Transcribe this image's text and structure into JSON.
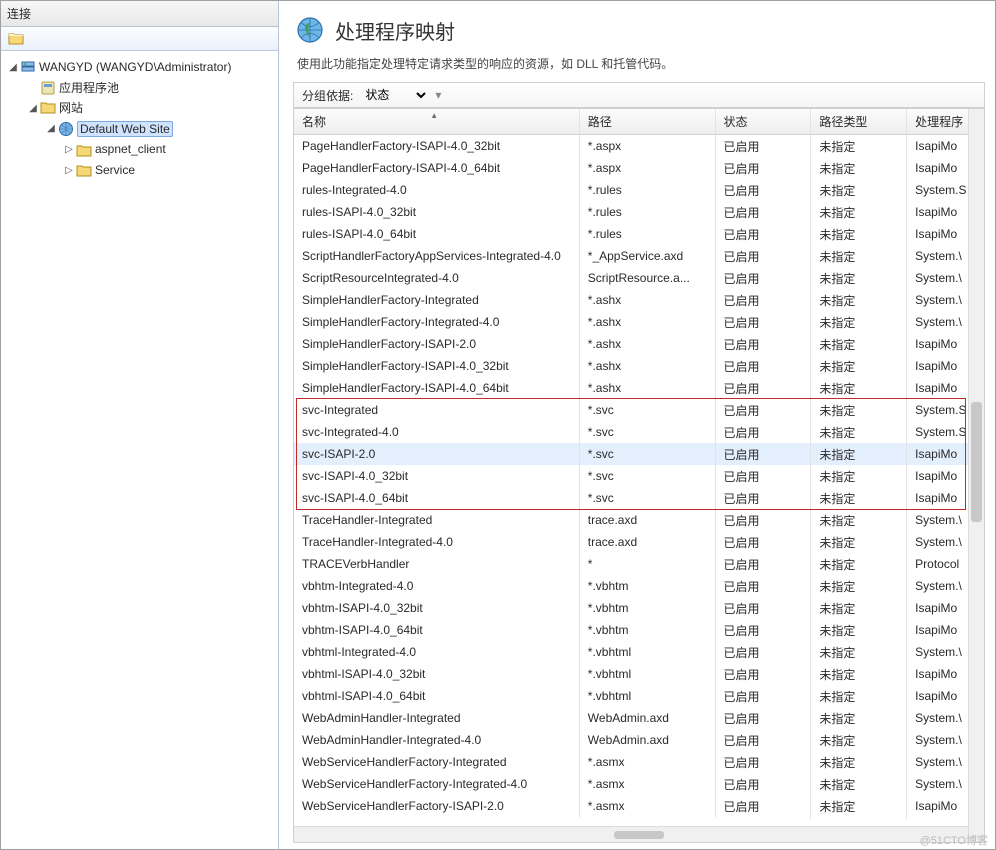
{
  "sidebar": {
    "header": "连接",
    "root_label": "WANGYD (WANGYD\\Administrator)",
    "app_pools": "应用程序池",
    "sites": "网站",
    "default_site": "Default Web Site",
    "child1": "aspnet_client",
    "child2": "Service"
  },
  "page": {
    "title": "处理程序映射",
    "description": "使用此功能指定处理特定请求类型的响应的资源，如 DLL 和托管代码。",
    "group_by_label": "分组依据:",
    "group_by_value": "状态"
  },
  "columns": [
    "名称",
    "路径",
    "状态",
    "路径类型",
    "处理程序"
  ],
  "rows": [
    {
      "name": "PageHandlerFactory-ISAPI-4.0_32bit",
      "path": "*.aspx",
      "state": "已启用",
      "ptype": "未指定",
      "handler": "IsapiMo"
    },
    {
      "name": "PageHandlerFactory-ISAPI-4.0_64bit",
      "path": "*.aspx",
      "state": "已启用",
      "ptype": "未指定",
      "handler": "IsapiMo"
    },
    {
      "name": "rules-Integrated-4.0",
      "path": "*.rules",
      "state": "已启用",
      "ptype": "未指定",
      "handler": "System.S"
    },
    {
      "name": "rules-ISAPI-4.0_32bit",
      "path": "*.rules",
      "state": "已启用",
      "ptype": "未指定",
      "handler": "IsapiMo"
    },
    {
      "name": "rules-ISAPI-4.0_64bit",
      "path": "*.rules",
      "state": "已启用",
      "ptype": "未指定",
      "handler": "IsapiMo"
    },
    {
      "name": "ScriptHandlerFactoryAppServices-Integrated-4.0",
      "path": "*_AppService.axd",
      "state": "已启用",
      "ptype": "未指定",
      "handler": "System.\\"
    },
    {
      "name": "ScriptResourceIntegrated-4.0",
      "path": "ScriptResource.a...",
      "state": "已启用",
      "ptype": "未指定",
      "handler": "System.\\"
    },
    {
      "name": "SimpleHandlerFactory-Integrated",
      "path": "*.ashx",
      "state": "已启用",
      "ptype": "未指定",
      "handler": "System.\\"
    },
    {
      "name": "SimpleHandlerFactory-Integrated-4.0",
      "path": "*.ashx",
      "state": "已启用",
      "ptype": "未指定",
      "handler": "System.\\"
    },
    {
      "name": "SimpleHandlerFactory-ISAPI-2.0",
      "path": "*.ashx",
      "state": "已启用",
      "ptype": "未指定",
      "handler": "IsapiMo"
    },
    {
      "name": "SimpleHandlerFactory-ISAPI-4.0_32bit",
      "path": "*.ashx",
      "state": "已启用",
      "ptype": "未指定",
      "handler": "IsapiMo"
    },
    {
      "name": "SimpleHandlerFactory-ISAPI-4.0_64bit",
      "path": "*.ashx",
      "state": "已启用",
      "ptype": "未指定",
      "handler": "IsapiMo"
    },
    {
      "name": "svc-Integrated",
      "path": "*.svc",
      "state": "已启用",
      "ptype": "未指定",
      "handler": "System.S",
      "hl": true
    },
    {
      "name": "svc-Integrated-4.0",
      "path": "*.svc",
      "state": "已启用",
      "ptype": "未指定",
      "handler": "System.S",
      "hl": true
    },
    {
      "name": "svc-ISAPI-2.0",
      "path": "*.svc",
      "state": "已启用",
      "ptype": "未指定",
      "handler": "IsapiMo",
      "hl": true,
      "sel": true
    },
    {
      "name": "svc-ISAPI-4.0_32bit",
      "path": "*.svc",
      "state": "已启用",
      "ptype": "未指定",
      "handler": "IsapiMo",
      "hl": true
    },
    {
      "name": "svc-ISAPI-4.0_64bit",
      "path": "*.svc",
      "state": "已启用",
      "ptype": "未指定",
      "handler": "IsapiMo",
      "hl": true
    },
    {
      "name": "TraceHandler-Integrated",
      "path": "trace.axd",
      "state": "已启用",
      "ptype": "未指定",
      "handler": "System.\\"
    },
    {
      "name": "TraceHandler-Integrated-4.0",
      "path": "trace.axd",
      "state": "已启用",
      "ptype": "未指定",
      "handler": "System.\\"
    },
    {
      "name": "TRACEVerbHandler",
      "path": "*",
      "state": "已启用",
      "ptype": "未指定",
      "handler": "Protocol"
    },
    {
      "name": "vbhtm-Integrated-4.0",
      "path": "*.vbhtm",
      "state": "已启用",
      "ptype": "未指定",
      "handler": "System.\\"
    },
    {
      "name": "vbhtm-ISAPI-4.0_32bit",
      "path": "*.vbhtm",
      "state": "已启用",
      "ptype": "未指定",
      "handler": "IsapiMo"
    },
    {
      "name": "vbhtm-ISAPI-4.0_64bit",
      "path": "*.vbhtm",
      "state": "已启用",
      "ptype": "未指定",
      "handler": "IsapiMo"
    },
    {
      "name": "vbhtml-Integrated-4.0",
      "path": "*.vbhtml",
      "state": "已启用",
      "ptype": "未指定",
      "handler": "System.\\"
    },
    {
      "name": "vbhtml-ISAPI-4.0_32bit",
      "path": "*.vbhtml",
      "state": "已启用",
      "ptype": "未指定",
      "handler": "IsapiMo"
    },
    {
      "name": "vbhtml-ISAPI-4.0_64bit",
      "path": "*.vbhtml",
      "state": "已启用",
      "ptype": "未指定",
      "handler": "IsapiMo"
    },
    {
      "name": "WebAdminHandler-Integrated",
      "path": "WebAdmin.axd",
      "state": "已启用",
      "ptype": "未指定",
      "handler": "System.\\"
    },
    {
      "name": "WebAdminHandler-Integrated-4.0",
      "path": "WebAdmin.axd",
      "state": "已启用",
      "ptype": "未指定",
      "handler": "System.\\"
    },
    {
      "name": "WebServiceHandlerFactory-Integrated",
      "path": "*.asmx",
      "state": "已启用",
      "ptype": "未指定",
      "handler": "System.\\"
    },
    {
      "name": "WebServiceHandlerFactory-Integrated-4.0",
      "path": "*.asmx",
      "state": "已启用",
      "ptype": "未指定",
      "handler": "System.\\"
    },
    {
      "name": "WebServiceHandlerFactory-ISAPI-2.0",
      "path": "*.asmx",
      "state": "已启用",
      "ptype": "未指定",
      "handler": "IsapiMo"
    }
  ],
  "watermark": "@51CTO博客"
}
